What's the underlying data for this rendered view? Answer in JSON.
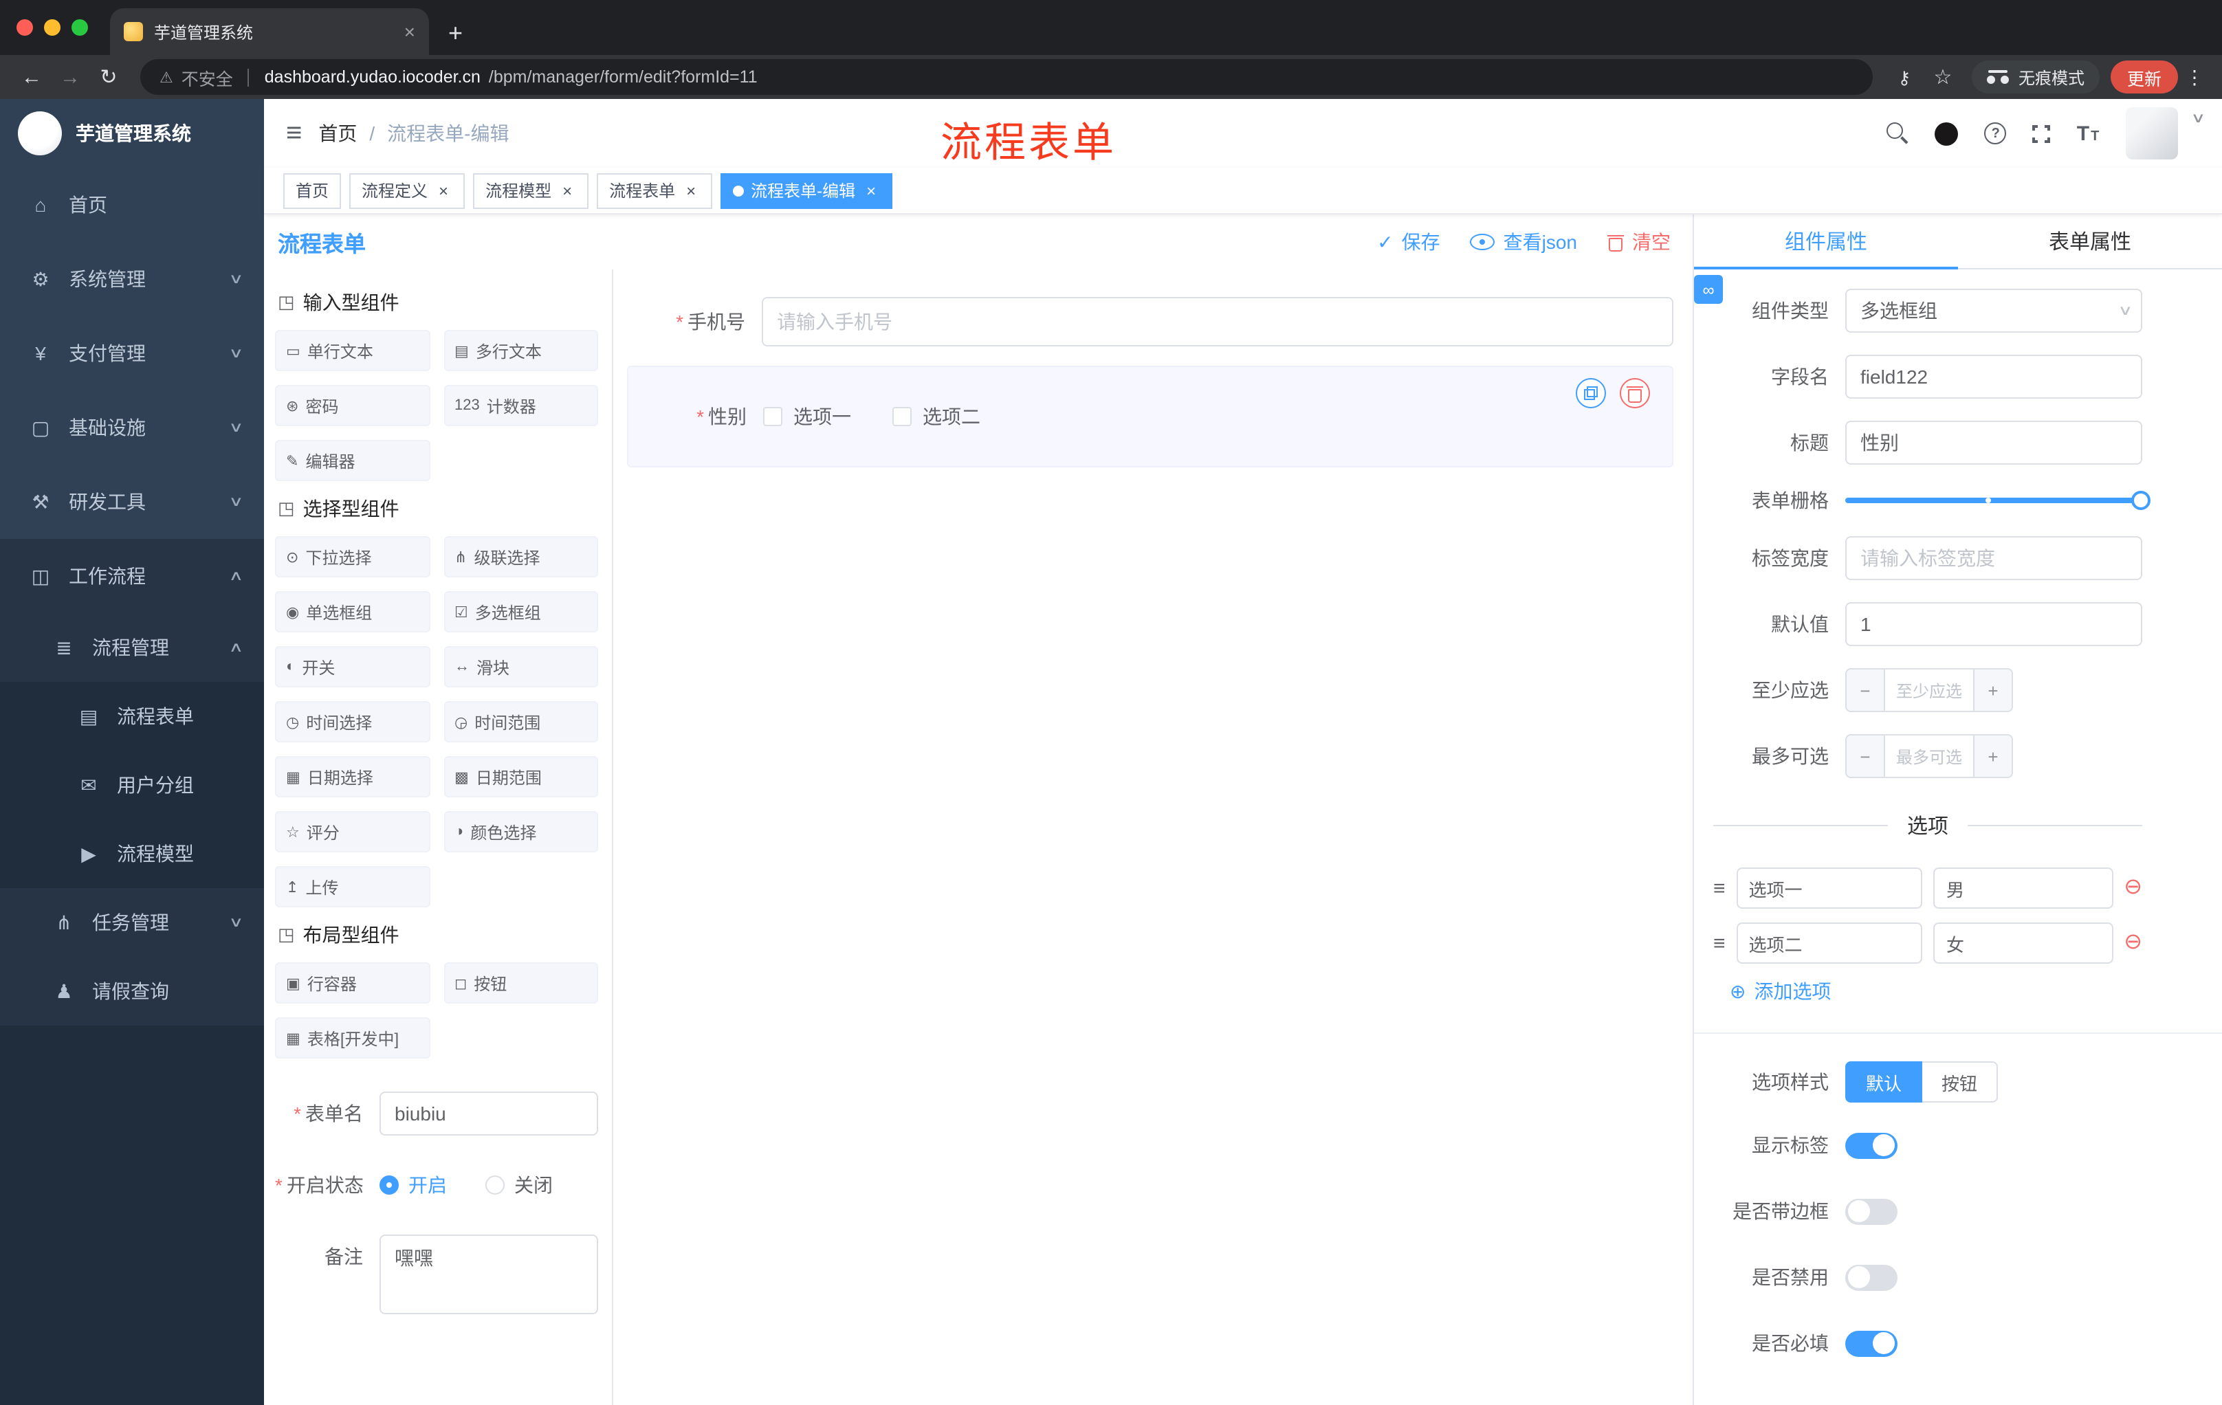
{
  "colors": {
    "primary": "#409eff",
    "danger": "#f56c6c",
    "annotation_red": "#f73b1e",
    "sidebar_bg": "#304156",
    "sidebar_sub_bg": "#1f2d3d",
    "update_button_red": "#dd4f43",
    "active_tag": "#409eff"
  },
  "icons": {
    "plus": "+",
    "close": "×",
    "warning": "⚠",
    "back": "←",
    "forward": "→",
    "reload": "↻",
    "key": "⚷",
    "star": "☆",
    "kebab": "⋮",
    "caret_down": "∨",
    "caret_up": "∧",
    "hamburger": "≡",
    "check": "✓",
    "question": "?",
    "font_big": "T",
    "font_small": "T",
    "cube": "◳",
    "link": "∞",
    "drag": "≡",
    "minus_circle": "⊖",
    "plus_circle": "⊕",
    "minus": "−"
  },
  "chrome": {
    "tab_title": "芋道管理系统",
    "security_label": "不安全",
    "url_host": "dashboard.yudao.iocoder.cn",
    "url_path": "/bpm/manager/form/edit?formId=11",
    "incognito_label": "无痕模式",
    "update_label": "更新"
  },
  "sidebar": {
    "title": "芋道管理系统",
    "items": [
      {
        "icon": "⌂",
        "label": "首页"
      },
      {
        "icon": "⚙",
        "label": "系统管理"
      },
      {
        "icon": "¥",
        "label": "支付管理"
      },
      {
        "icon": "▢",
        "label": "基础设施"
      },
      {
        "icon": "⚒",
        "label": "研发工具"
      },
      {
        "icon": "◫",
        "label": "工作流程"
      },
      {
        "icon": "≣",
        "label": "流程管理"
      },
      {
        "icon": "▤",
        "label": "流程表单"
      },
      {
        "icon": "✉",
        "label": "用户分组"
      },
      {
        "icon": "▶",
        "label": "流程模型"
      },
      {
        "icon": "⋔",
        "label": "任务管理"
      },
      {
        "icon": "♟",
        "label": "请假查询"
      }
    ]
  },
  "header": {
    "breadcrumb_home": "首页",
    "breadcrumb_sep": "/",
    "breadcrumb_current": "流程表单-编辑",
    "annotation": "流程表单"
  },
  "tags": [
    {
      "label": "首页"
    },
    {
      "label": "流程定义"
    },
    {
      "label": "流程模型"
    },
    {
      "label": "流程表单"
    },
    {
      "label": "流程表单-编辑"
    }
  ],
  "editor": {
    "title": "流程表单",
    "actions": {
      "save": "保存",
      "view_json": "查看json",
      "clear": "清空"
    },
    "palette": {
      "groups": [
        {
          "title": "输入型组件",
          "items": [
            {
              "icon": "▭",
              "label": "单行文本"
            },
            {
              "icon": "▤",
              "label": "多行文本"
            },
            {
              "icon": "⊛",
              "label": "密码"
            },
            {
              "icon": "123",
              "label": "计数器"
            },
            {
              "icon": "✎",
              "label": "编辑器"
            }
          ]
        },
        {
          "title": "选择型组件",
          "items": [
            {
              "icon": "⊙",
              "label": "下拉选择"
            },
            {
              "icon": "⋔",
              "label": "级联选择"
            },
            {
              "icon": "◉",
              "label": "单选框组"
            },
            {
              "icon": "☑",
              "label": "多选框组"
            },
            {
              "icon": "◐",
              "label": "开关"
            },
            {
              "icon": "↔",
              "label": "滑块"
            },
            {
              "icon": "◷",
              "label": "时间选择"
            },
            {
              "icon": "◶",
              "label": "时间范围"
            },
            {
              "icon": "▦",
              "label": "日期选择"
            },
            {
              "icon": "▩",
              "label": "日期范围"
            },
            {
              "icon": "☆",
              "label": "评分"
            },
            {
              "icon": "◑",
              "label": "颜色选择"
            },
            {
              "icon": "↥",
              "label": "上传"
            }
          ]
        },
        {
          "title": "布局型组件",
          "items": [
            {
              "icon": "▣",
              "label": "行容器"
            },
            {
              "icon": "◻",
              "label": "按钮"
            },
            {
              "icon": "▦",
              "label": "表格[开发中]"
            }
          ]
        }
      ]
    },
    "meta": {
      "form_name_label": "表单名",
      "form_name_value": "biubiu",
      "status_label": "开启状态",
      "status_on": "开启",
      "status_off": "关闭",
      "remark_label": "备注",
      "remark_value": "嘿嘿"
    },
    "canvas": {
      "phone_label": "手机号",
      "phone_placeholder": "请输入手机号",
      "gender_label": "性别",
      "gender_option1": "选项一",
      "gender_option2": "选项二"
    }
  },
  "props": {
    "tab_component": "组件属性",
    "tab_form": "表单属性",
    "component_type_label": "组件类型",
    "component_type_value": "多选框组",
    "field_name_label": "字段名",
    "field_name_value": "field122",
    "title_label": "标题",
    "title_value": "性别",
    "grid_label": "表单栅格",
    "label_width_label": "标签宽度",
    "label_width_placeholder": "请输入标签宽度",
    "default_label": "默认值",
    "default_value": "1",
    "min_label": "至少应选",
    "min_placeholder": "至少应选",
    "max_label": "最多可选",
    "max_placeholder": "最多可选",
    "options_divider": "选项",
    "options": [
      {
        "name": "选项一",
        "value": "男"
      },
      {
        "name": "选项二",
        "value": "女"
      }
    ],
    "add_option": "添加选项",
    "style_label": "选项样式",
    "style_default": "默认",
    "style_button": "按钮",
    "show_label": "显示标签",
    "border_label": "是否带边框",
    "disabled_label": "是否禁用",
    "required_label": "是否必填"
  }
}
